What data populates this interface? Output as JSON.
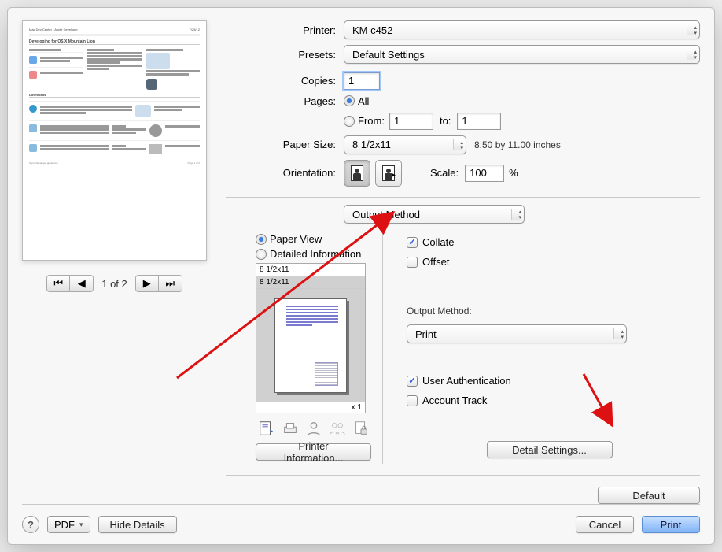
{
  "labels": {
    "printer": "Printer:",
    "presets": "Presets:",
    "copies": "Copies:",
    "pages": "Pages:",
    "all": "All",
    "from": "From:",
    "to": "to:",
    "paper_size": "Paper Size:",
    "orientation": "Orientation:",
    "scale": "Scale:",
    "percent": "%",
    "paper_dim_note": "8.50 by 11.00 inches"
  },
  "values": {
    "printer": "KM c452",
    "preset": "Default Settings",
    "copies": "1",
    "pages_mode": "all",
    "from": "1",
    "to": "1",
    "paper_size": "8 1/2x11",
    "scale": "100"
  },
  "section_popup": "Output Method",
  "output": {
    "view_mode": "paper",
    "paper_view": "Paper View",
    "detailed": "Detailed Information",
    "paper_label1": "8 1/2x11",
    "paper_label2": "8 1/2x11",
    "x1": "x 1",
    "printer_info": "Printer Information...",
    "collate": "Collate",
    "collate_checked": true,
    "offset": "Offset",
    "offset_checked": false,
    "method_label": "Output Method:",
    "method_value": "Print",
    "user_auth": "User Authentication",
    "user_auth_checked": true,
    "account_track": "Account Track",
    "account_track_checked": false,
    "detail_settings": "Detail Settings...",
    "default_btn": "Default"
  },
  "pager": {
    "label": "1 of 2"
  },
  "footer": {
    "pdf": "PDF",
    "hide_details": "Hide Details",
    "cancel": "Cancel",
    "print": "Print"
  },
  "preview": {
    "title": "Developing for OS X Mountain Lion"
  }
}
